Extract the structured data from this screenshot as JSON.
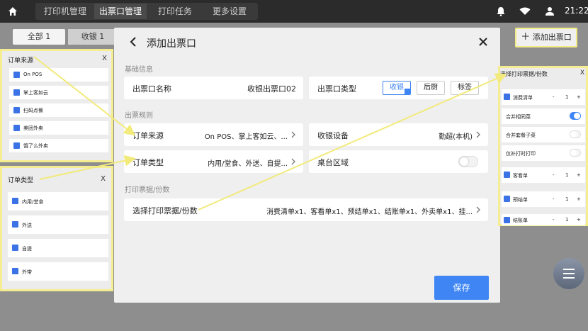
{
  "topbar": {
    "tabs": [
      {
        "label": "打印机管理"
      },
      {
        "label": "出票口管理",
        "active": true
      },
      {
        "label": "打印任务"
      },
      {
        "label": "更多设置"
      }
    ],
    "time": "21:22"
  },
  "background": {
    "subtabs": [
      {
        "label": "全部 1"
      },
      {
        "label": "收银 1"
      }
    ],
    "add_button": "添加出票口"
  },
  "modal": {
    "title": "添加出票口",
    "sections": {
      "basic": "基础信息",
      "rules": "出票规则",
      "receipts": "打印票据/份数"
    },
    "name_label": "出票口名称",
    "name_value": "收银出票口02",
    "type_label": "出票口类型",
    "type_options": [
      "收银",
      "后厨",
      "标签"
    ],
    "order_source_label": "订单来源",
    "order_source_value": "On POS、掌上客如云、...",
    "device_label": "收银设备",
    "device_value": "勤超(本机)",
    "order_type_label": "订单类型",
    "order_type_value": "内用/堂食、外送、自提...",
    "table_area_label": "桌台区域",
    "table_area_enabled": false,
    "receipts_label": "选择打印票据/份数",
    "receipts_value": "消费清单x1、客看单x1、预结单x1、结账单x1、外卖单x1、挂...",
    "save": "保存"
  },
  "order_source_panel": {
    "title": "订单来源",
    "close": "X",
    "items": [
      "On POS",
      "掌上客如云",
      "扫码点餐",
      "美团外卖",
      "饿了么外卖"
    ]
  },
  "order_type_panel": {
    "title": "订单类型",
    "close": "X",
    "items": [
      "内用/堂食",
      "外送",
      "自提",
      "外带"
    ]
  },
  "receipt_panel": {
    "title": "选择打印票据/份数",
    "close": "X",
    "rows": [
      {
        "label": "消费清单",
        "minus": "-",
        "qty": "1",
        "plus": "+"
      },
      {
        "label": "合并相同菜",
        "toggle": true
      },
      {
        "label": "合并套餐子菜",
        "toggle": false
      },
      {
        "label": "仅补打时打印",
        "toggle": false
      },
      {
        "label": "客看单",
        "minus": "-",
        "qty": "1",
        "plus": "+"
      },
      {
        "label": "预结单",
        "minus": "-",
        "qty": "1",
        "plus": "+"
      },
      {
        "label": "结账单",
        "minus": "-",
        "qty": "1",
        "plus": "+"
      }
    ]
  },
  "colors": {
    "accent": "#3f86f4",
    "highlight": "#f5ed92",
    "topbar": "#2b2b2b"
  }
}
